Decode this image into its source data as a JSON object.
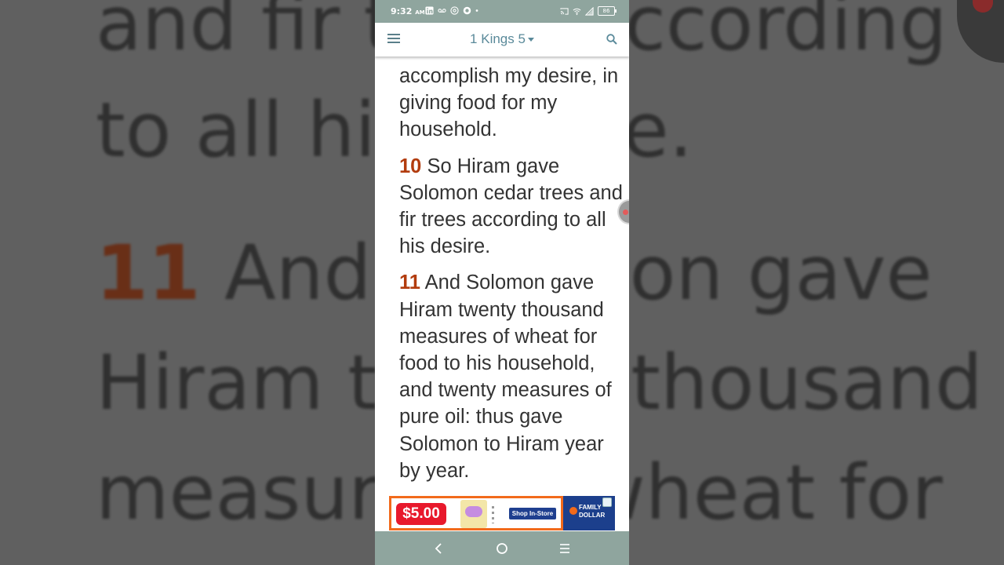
{
  "background": {
    "lines": [
      {
        "num": "",
        "text": "and fir trees according"
      },
      {
        "num": "",
        "text": "to all his desire."
      },
      {
        "num": "11",
        "text": "And Solomon gave"
      },
      {
        "num": "",
        "text": "Hiram twenty thousand"
      },
      {
        "num": "",
        "text": "measures of wheat for"
      }
    ]
  },
  "status": {
    "time": "9:32",
    "ampm": "AM",
    "battery": "86"
  },
  "appbar": {
    "title": "1 Kings 5"
  },
  "content": {
    "partial_verse": "accomplish my desire, in giving food for my household.",
    "verses": [
      {
        "num": "10",
        "text": "So Hiram gave Solomon cedar trees and fir trees according to all his desire."
      },
      {
        "num": "11",
        "text": "And Solomon gave Hiram twenty thousand measures of wheat for food to his household, and twenty measures of pure oil: thus gave Solomon to Hiram year by year."
      }
    ]
  },
  "ad": {
    "price": "$5.00",
    "button": "Shop In-Store",
    "brand_line1": "FAMILY",
    "brand_line2": "DOLLAR",
    "colors": {
      "price_bg": "#e8192c",
      "border": "#f26a1b",
      "brand_bg": "#1c3f8c"
    }
  },
  "colors": {
    "status_bar": "#8fa59e",
    "title": "#5a8a9a",
    "verse_number": "#b23c0e",
    "body_text": "#333333"
  },
  "icons": [
    "menu-icon",
    "caret-down-icon",
    "search-icon",
    "back-icon",
    "home-icon",
    "recents-icon"
  ]
}
